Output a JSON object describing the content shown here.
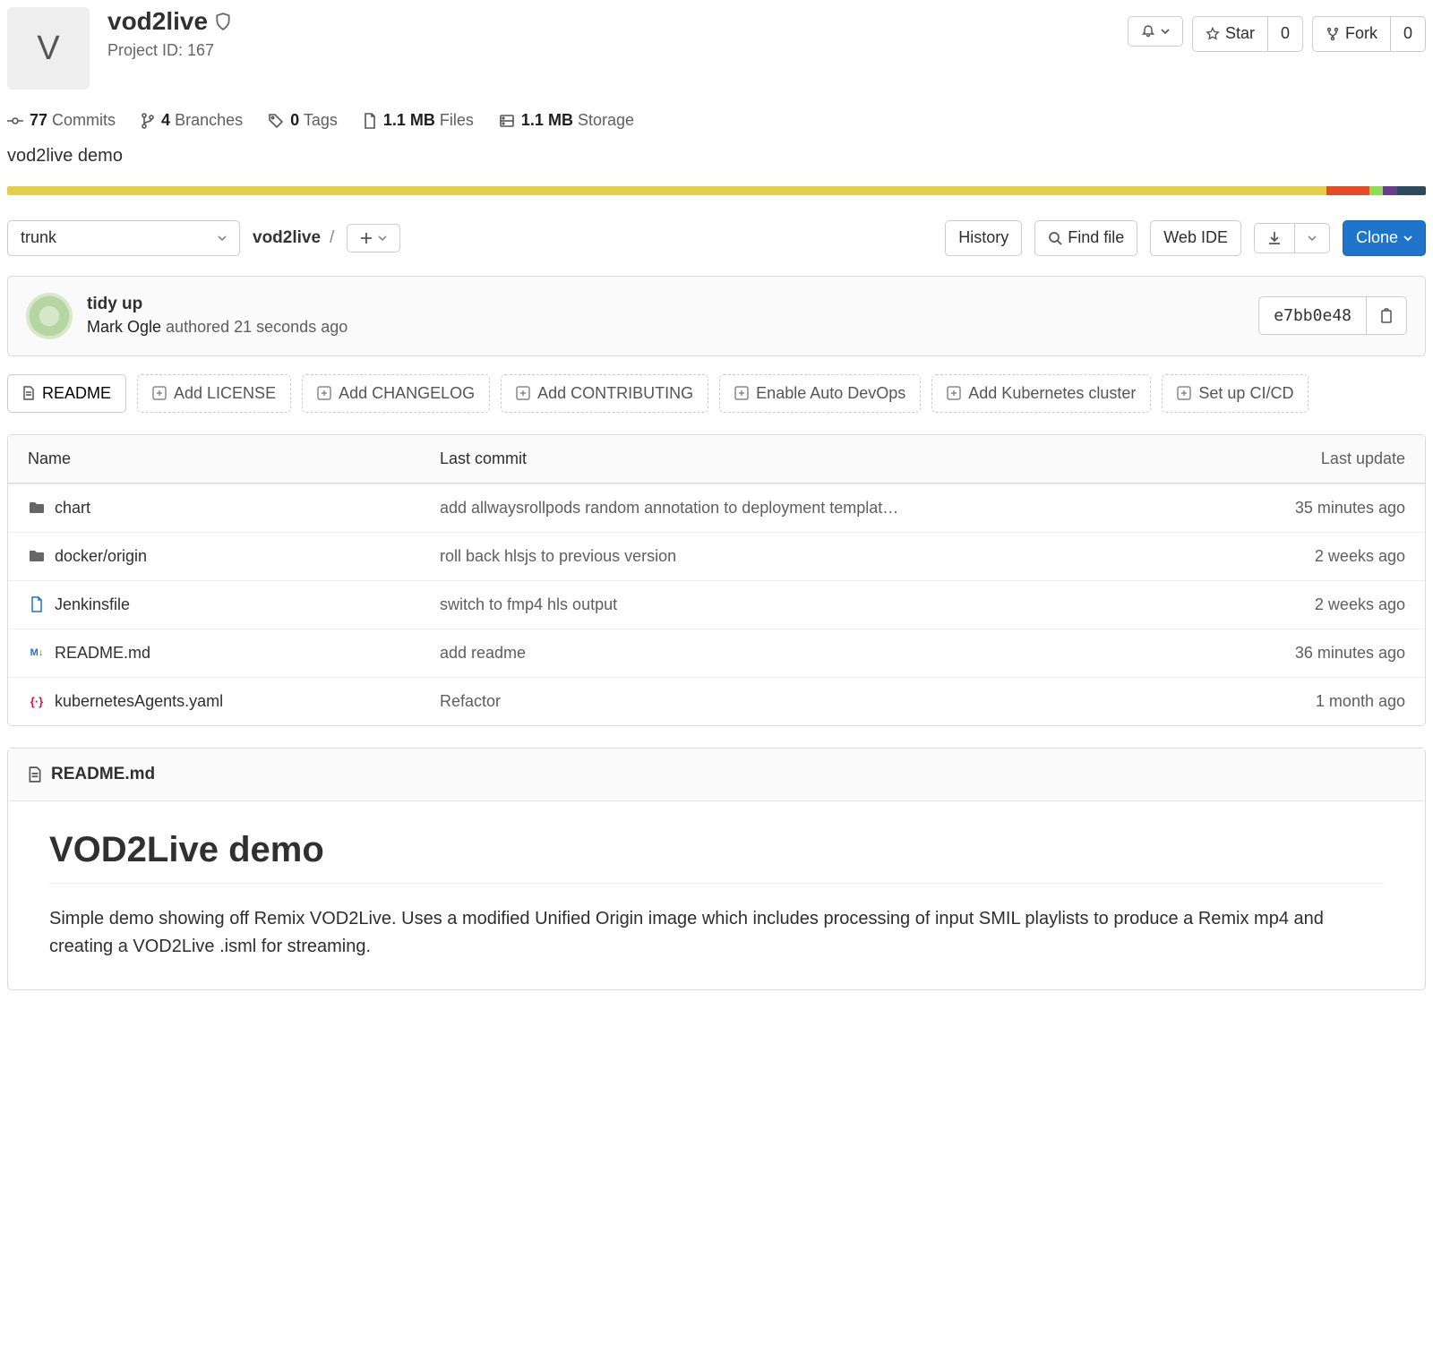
{
  "project": {
    "avatar_letter": "V",
    "name": "vod2live",
    "id_label": "Project ID: 167",
    "description": "vod2live demo"
  },
  "header_actions": {
    "star_label": "Star",
    "star_count": "0",
    "fork_label": "Fork",
    "fork_count": "0"
  },
  "stats": {
    "commits_count": "77",
    "commits_label": "Commits",
    "branches_count": "4",
    "branches_label": "Branches",
    "tags_count": "0",
    "tags_label": "Tags",
    "files_size": "1.1 MB",
    "files_label": "Files",
    "storage_size": "1.1 MB",
    "storage_label": "Storage"
  },
  "languages": [
    {
      "color": "#e4cf4d",
      "width": "93%"
    },
    {
      "color": "#e34c26",
      "width": "3%"
    },
    {
      "color": "#89e051",
      "width": "1%"
    },
    {
      "color": "#6a3d8b",
      "width": "1%"
    },
    {
      "color": "#2e4a5d",
      "width": "2%"
    }
  ],
  "repo_controls": {
    "branch": "trunk",
    "breadcrumb_root": "vod2live",
    "history": "History",
    "find_file": "Find file",
    "web_ide": "Web IDE",
    "clone": "Clone"
  },
  "last_commit": {
    "title": "tidy up",
    "author": "Mark Ogle",
    "authored_label": "authored",
    "time": "21 seconds ago",
    "sha": "e7bb0e48"
  },
  "chips": {
    "readme": "README",
    "add_license": "Add LICENSE",
    "add_changelog": "Add CHANGELOG",
    "add_contributing": "Add CONTRIBUTING",
    "auto_devops": "Enable Auto DevOps",
    "k8s": "Add Kubernetes cluster",
    "cicd": "Set up CI/CD"
  },
  "files": {
    "header": {
      "name": "Name",
      "commit": "Last commit",
      "update": "Last update"
    },
    "rows": [
      {
        "icon": "folder",
        "name": "chart",
        "commit": "add allwaysrollpods random annotation to deployment templat…",
        "update": "35 minutes ago"
      },
      {
        "icon": "folder",
        "name": "docker/origin",
        "commit": "roll back hlsjs to previous version",
        "update": "2 weeks ago"
      },
      {
        "icon": "file",
        "name": "Jenkinsfile",
        "commit": "switch to fmp4 hls output",
        "update": "2 weeks ago"
      },
      {
        "icon": "md",
        "name": "README.md",
        "commit": "add readme",
        "update": "36 minutes ago"
      },
      {
        "icon": "yaml",
        "name": "kubernetesAgents.yaml",
        "commit": "Refactor",
        "update": "1 month ago"
      }
    ]
  },
  "readme": {
    "filename": "README.md",
    "h1": "VOD2Live demo",
    "p1": "Simple demo showing off Remix VOD2Live. Uses a modified Unified Origin image which includes processing of input SMIL playlists to produce a Remix mp4 and creating a VOD2Live .isml for streaming."
  }
}
